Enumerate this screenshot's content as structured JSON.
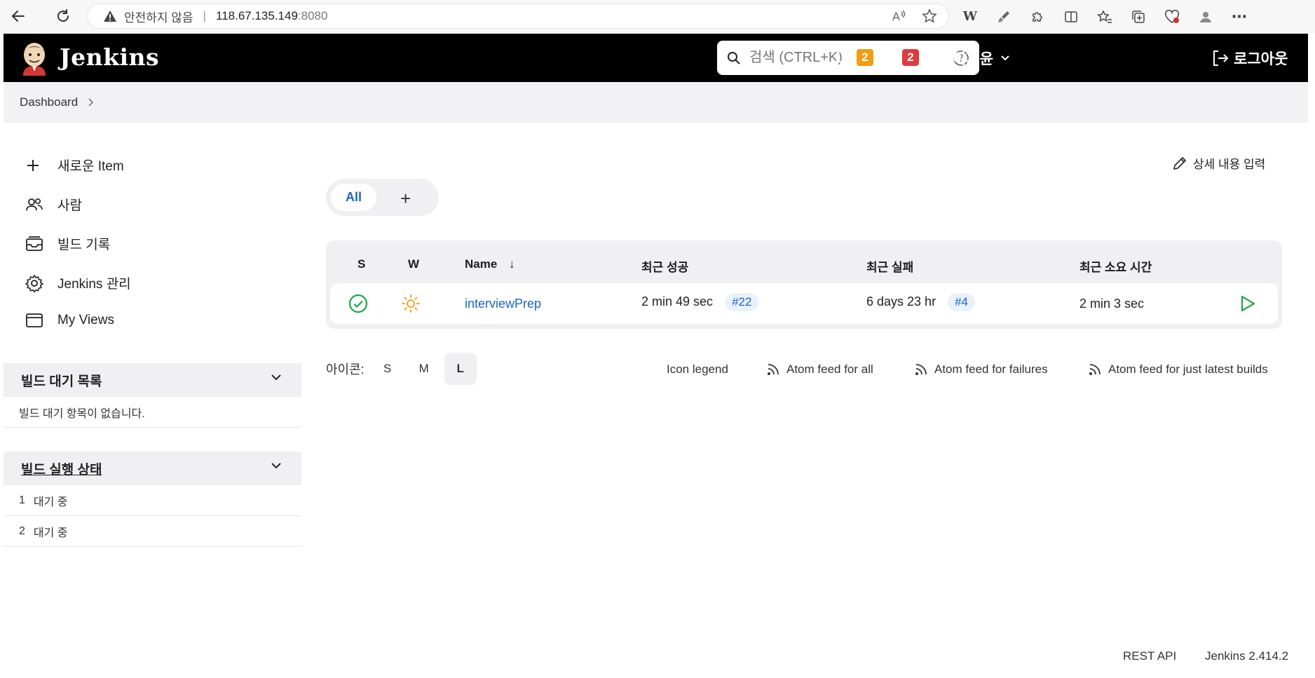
{
  "browser": {
    "insecure_label": "안전하지 않음",
    "separator": "|",
    "host": "118.67.135.149",
    "port": ":8080"
  },
  "header": {
    "title": "Jenkins",
    "search_placeholder": "검색 (CTRL+K)",
    "notifications_count": "2",
    "security_count": "2",
    "user_name": "이재윤",
    "logout_label": "로그아웃"
  },
  "breadcrumb": {
    "items": [
      "Dashboard"
    ]
  },
  "sidebar": {
    "tasks": [
      {
        "label": "새로운 Item",
        "icon": "plus-icon"
      },
      {
        "label": "사람",
        "icon": "people-icon"
      },
      {
        "label": "빌드 기록",
        "icon": "build-history-icon"
      },
      {
        "label": "Jenkins 관리",
        "icon": "gear-icon"
      },
      {
        "label": "My Views",
        "icon": "window-icon"
      }
    ],
    "queue": {
      "title": "빌드 대기 목록",
      "empty_text": "빌드 대기 항목이 없습니다."
    },
    "executors": {
      "title": "빌드 실행 상태",
      "rows": [
        {
          "num": "1",
          "status": "대기 중"
        },
        {
          "num": "2",
          "status": "대기 중"
        }
      ]
    }
  },
  "main": {
    "edit_description": "상세 내용 입력",
    "tabs": {
      "all": "All",
      "add": "+"
    },
    "table": {
      "headers": {
        "s": "S",
        "w": "W",
        "name": "Name",
        "name_sort": "↓",
        "last_success": "최근 성공",
        "last_failure": "최근 실패",
        "last_duration": "최근 소요 시간"
      },
      "rows": [
        {
          "name": "interviewPrep",
          "last_success": "2 min 49 sec",
          "last_success_build": "#22",
          "last_failure": "6 days 23 hr",
          "last_failure_build": "#4",
          "last_duration": "2 min 3 sec",
          "status": "success",
          "weather": "sunny"
        }
      ]
    },
    "icon_size": {
      "label": "아이콘:",
      "options": [
        "S",
        "M",
        "L"
      ],
      "selected": "L"
    },
    "links": {
      "legend": "Icon legend",
      "feed_all": "Atom feed for all",
      "feed_failures": "Atom feed for failures",
      "feed_latest": "Atom feed for just latest builds"
    }
  },
  "footer": {
    "rest_api": "REST API",
    "version": "Jenkins 2.414.2"
  },
  "colors": {
    "accent": "#1a66c4",
    "success": "#1ea64b",
    "weather": "#f5a623",
    "badge_orange": "#f39c12",
    "badge_red": "#e03a3e"
  }
}
